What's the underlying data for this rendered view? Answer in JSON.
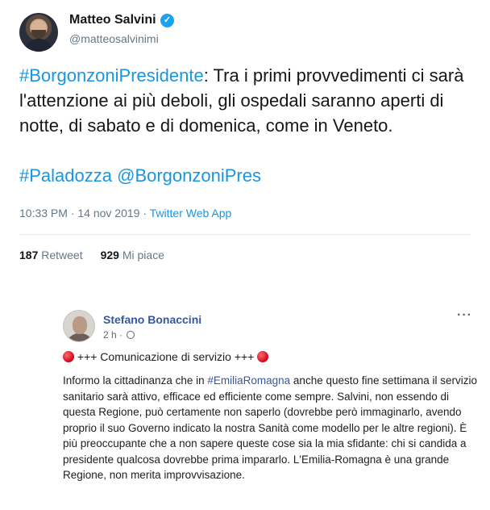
{
  "tweet": {
    "name": "Matteo Salvini",
    "handle": "@matteosalvinimi",
    "hashtag_main": "#BorgonzoniPresidente",
    "text": ": Tra i primi provvedimenti ci sarà l'attenzione ai più deboli, gli ospedali saranno aperti di notte, di sabato e di domenica, come in Veneto.",
    "hashtag_2": "#Paladozza",
    "mention": "@BorgonzoniPres",
    "timestamp": "10:33 PM · 14 nov 2019 · ",
    "source": "Twitter Web App",
    "retweets_count": "187",
    "retweets_label": "Retweet",
    "likes_count": "929",
    "likes_label": "Mi piace",
    "verified_icon": "verified-badge-icon"
  },
  "facebook_post": {
    "name": "Stefano Bonaccini",
    "time": "2 h · ",
    "more_label": "···",
    "headline": " +++ Comunicazione di servizio +++ ",
    "body_before_tag": "Informo la cittadinanza che in ",
    "body_tag": "#EmiliaRomagna",
    "body_after_tag": " anche questo fine settimana il servizio sanitario sarà attivo, efficace ed efficiente come sempre. Salvini, non essendo di questa Regione, può certamente non saperlo (dovrebbe però immaginarlo, avendo proprio il suo Governo indicato la nostra Sanità come modello per le altre regioni). È più preoccupante che a non sapere queste cose sia la mia sfidante: chi si candida a presidente qualcosa dovrebbe prima impararlo. L'Emilia-Romagna è una grande Regione, non merita improvvisazione."
  },
  "colors": {
    "twitter_link": "#1b95e0",
    "facebook_link": "#385898",
    "red_circle": "#d0021b"
  }
}
